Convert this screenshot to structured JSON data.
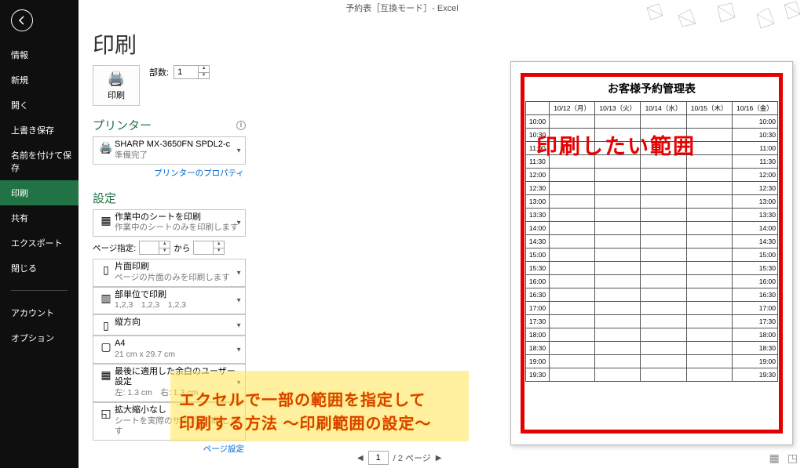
{
  "title": "予約表［互換モード］- Excel",
  "sidebar": {
    "items": [
      "情報",
      "新規",
      "開く",
      "上書き保存",
      "名前を付けて保存",
      "印刷",
      "共有",
      "エクスポート",
      "閉じる"
    ],
    "items2": [
      "アカウント",
      "オプション"
    ],
    "active_index": 5
  },
  "heading": "印刷",
  "print_btn_label": "印刷",
  "copies_label": "部数:",
  "copies_value": "1",
  "printer_section": "プリンター",
  "printer": {
    "name": "SHARP MX-3650FN SPDL2-c",
    "status": "準備完了"
  },
  "printer_props": "プリンターのプロパティ",
  "settings_section": "設定",
  "setting_scope": {
    "t": "作業中のシートを印刷",
    "s": "作業中のシートのみを印刷します"
  },
  "page_row": {
    "label": "ページ指定:",
    "to": "から"
  },
  "setting_sides": {
    "t": "片面印刷",
    "s": "ページの片面のみを印刷します"
  },
  "setting_collate": {
    "t": "部単位で印刷",
    "s": "1,2,3　1,2,3　1,2,3"
  },
  "setting_orient": {
    "t": "縦方向"
  },
  "setting_size": {
    "t": "A4",
    "s": "21 cm x 29.7 cm"
  },
  "setting_margin": {
    "t": "最後に適用した余白のユーザー設定",
    "s": "左: 1.3 cm　右: 1.3 cm"
  },
  "setting_scale": {
    "t": "拡大縮小なし",
    "s": "シートを実際のサイズで印刷します"
  },
  "page_setup_link": "ページ設定",
  "highlight": {
    "l1": "エクセルで一部の範囲を指定して",
    "l2": "印刷する方法 〜印刷範囲の設定〜"
  },
  "preview": {
    "title": "お客様予約管理表",
    "red_annot": "印刷したい範囲",
    "dates": [
      "10/12（月）",
      "10/13（火）",
      "10/14（水）",
      "10/15（木）",
      "10/16（金）"
    ],
    "times": [
      "10:00",
      "10:30",
      "11:00",
      "11:30",
      "12:00",
      "12:30",
      "13:00",
      "13:30",
      "14:00",
      "14:30",
      "15:00",
      "15:30",
      "16:00",
      "16:30",
      "17:00",
      "17:30",
      "18:00",
      "18:30",
      "19:00",
      "19:30"
    ]
  },
  "pager": {
    "page": "1",
    "total_suffix": "/ 2 ページ"
  }
}
